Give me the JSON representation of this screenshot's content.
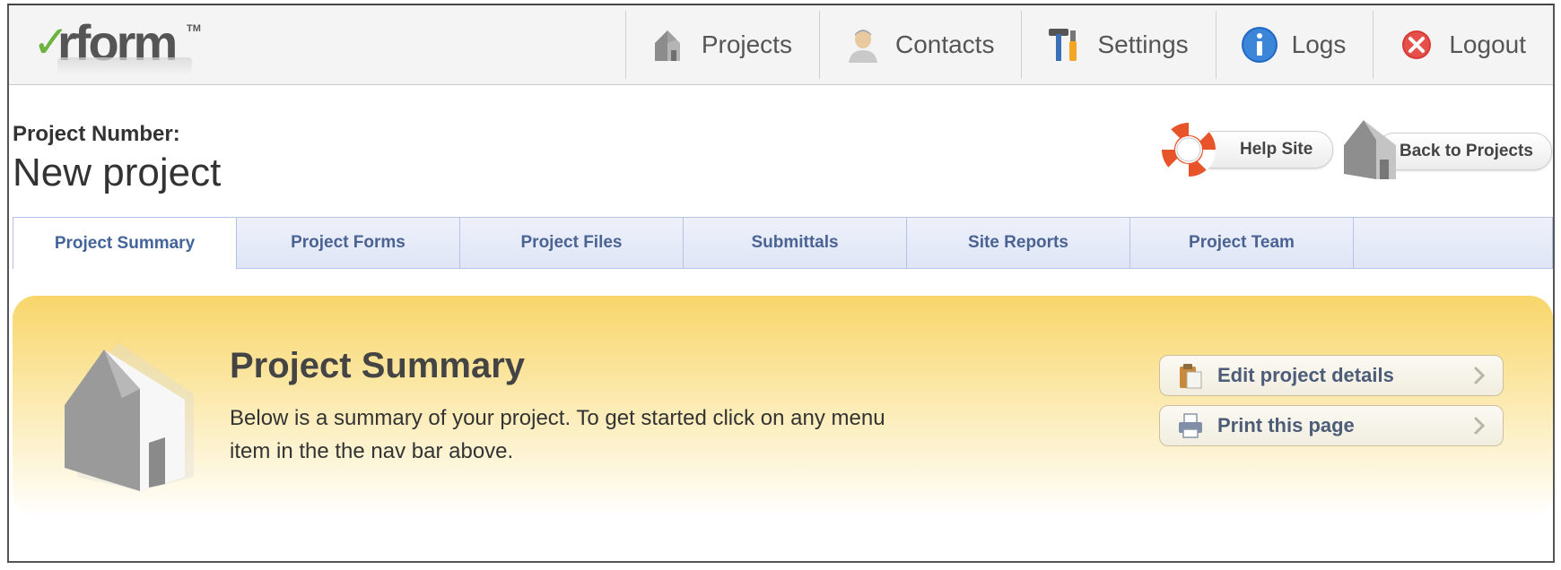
{
  "app": {
    "logo_word": "rform",
    "logo_tm": "TM"
  },
  "nav": {
    "items": [
      {
        "label": "Projects",
        "icon": "house-icon"
      },
      {
        "label": "Contacts",
        "icon": "person-icon"
      },
      {
        "label": "Settings",
        "icon": "tools-icon"
      },
      {
        "label": "Logs",
        "icon": "info-icon"
      },
      {
        "label": "Logout",
        "icon": "close-icon"
      }
    ]
  },
  "project": {
    "number_label": "Project Number:",
    "name": "New project"
  },
  "actions": {
    "help_label": "Help Site",
    "back_label": "Back to Projects"
  },
  "tabs": [
    {
      "label": "Project Summary",
      "active": true
    },
    {
      "label": "Project Forms"
    },
    {
      "label": "Project Files"
    },
    {
      "label": "Submittals"
    },
    {
      "label": "Site Reports"
    },
    {
      "label": "Project Team"
    }
  ],
  "summary": {
    "title": "Project Summary",
    "description": "Below is a summary of your project. To get started click on any menu item in the the nav bar above.",
    "buttons": [
      {
        "label": "Edit project details",
        "icon": "clipboard-icon"
      },
      {
        "label": "Print this page",
        "icon": "printer-icon"
      }
    ]
  },
  "colors": {
    "tab_text": "#4a6393",
    "panel_top": "#f8d66a",
    "logo_check": "#6db33f"
  }
}
